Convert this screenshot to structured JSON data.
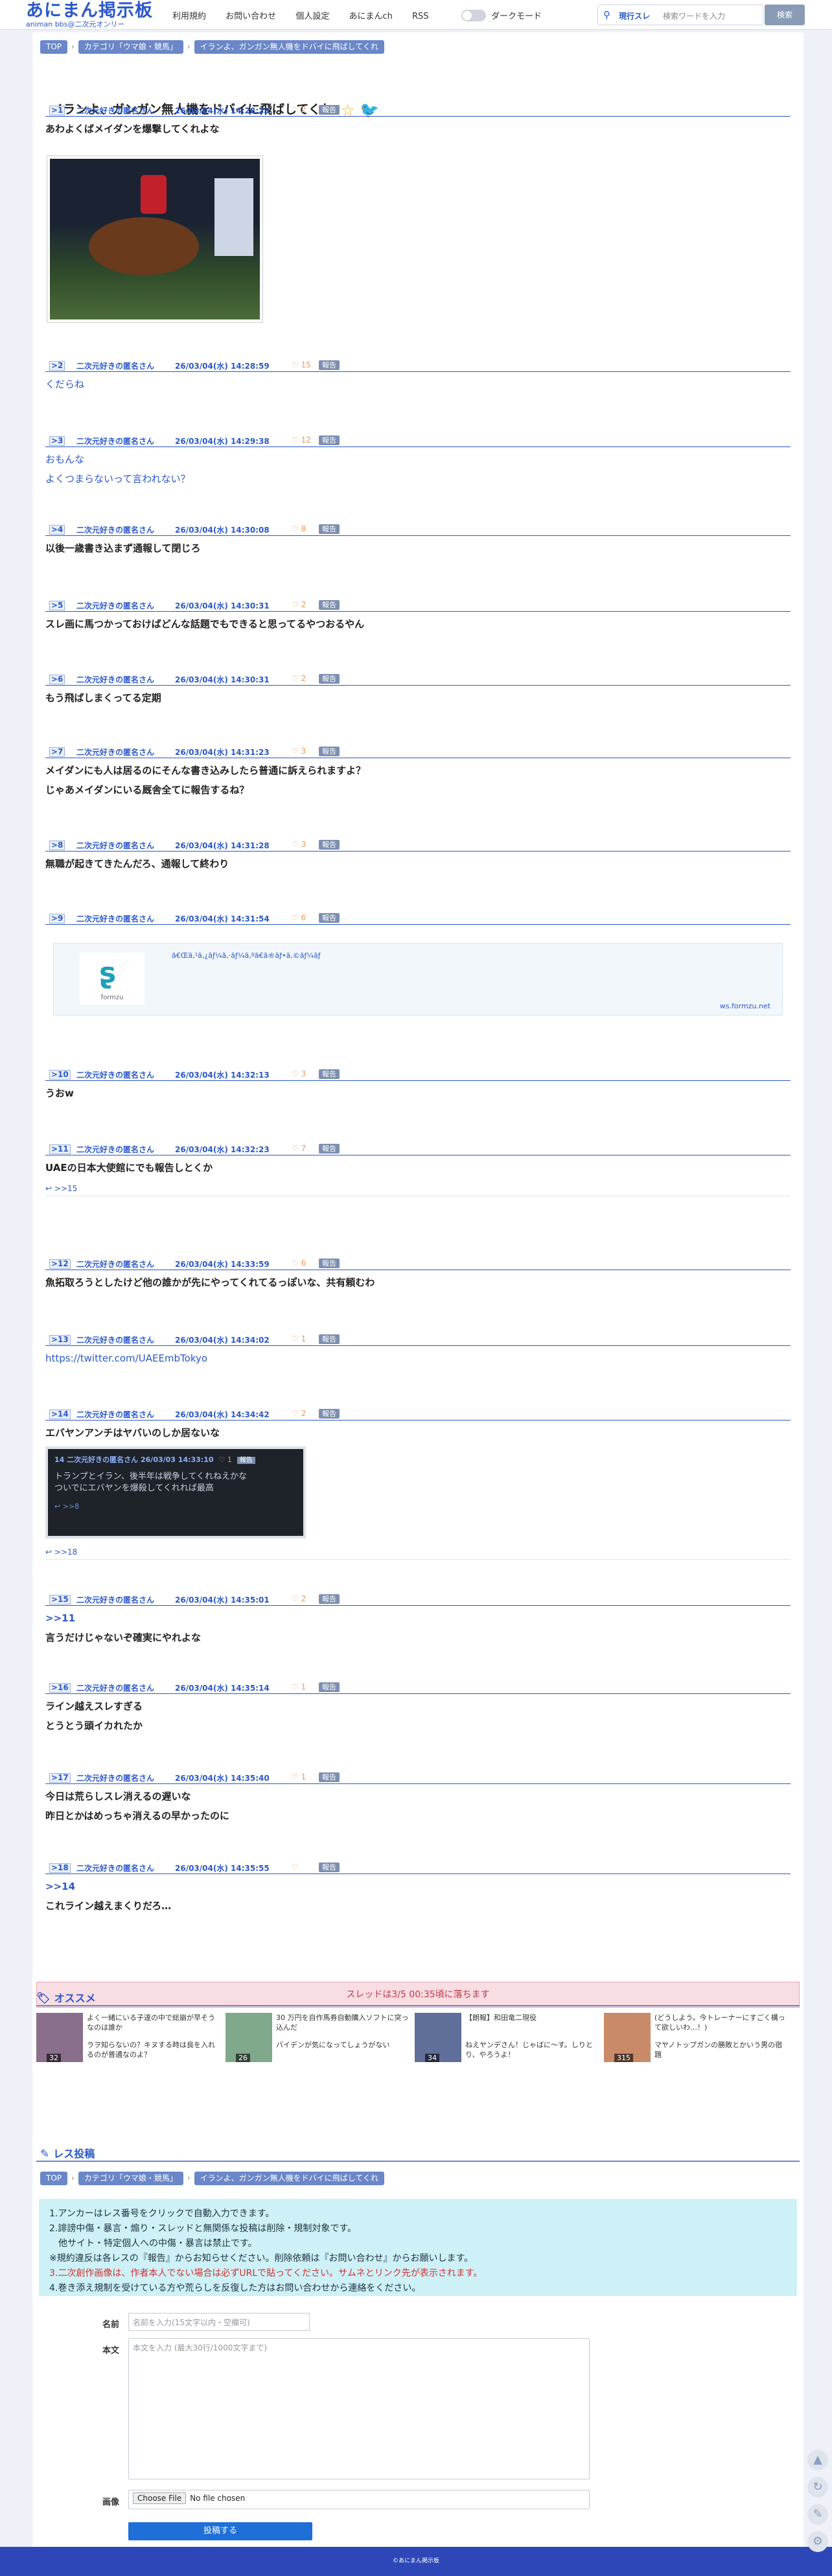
{
  "header": {
    "logo_title": "あにまん掲示板",
    "logo_sub": "animan bbs@二次元オンリー",
    "nav": [
      "利用規約",
      "お問い合わせ",
      "個人設定",
      "あにまんch",
      "RSS"
    ],
    "dark_mode_label": "ダークモード",
    "search_scope": "現行スレ",
    "search_placeholder": "検索ワードを入力",
    "search_button": "検索"
  },
  "breadcrumb": [
    "TOP",
    "カテゴリ「ウマ娘・競馬」",
    "イランよ、ガンガン無人機をドバイに飛ばしてくれ"
  ],
  "thread_title": "イランよ、ガンガン無人機をドバイに飛ばしてくれ",
  "report_label": "報告",
  "posts": [
    {
      "no": "1",
      "name": "二次元好きの匿名さん",
      "date": "26/03/04(水) 14:28:23",
      "likes": "2",
      "lines": [
        "あわよくばメイダンを爆撃してくれよな"
      ]
    },
    {
      "no": "2",
      "name": "二次元好きの匿名さん",
      "date": "26/03/04(水) 14:28:59",
      "likes": "15",
      "lines": [
        "くだらね"
      ]
    },
    {
      "no": "3",
      "name": "二次元好きの匿名さん",
      "date": "26/03/04(水) 14:29:38",
      "likes": "12",
      "lines": [
        "おもんな",
        "よくつまらないって言われない？"
      ]
    },
    {
      "no": "4",
      "name": "二次元好きの匿名さん",
      "date": "26/03/04(水) 14:30:08",
      "likes": "8",
      "lines": [
        "以後一歳書き込まず通報して閉じろ"
      ]
    },
    {
      "no": "5",
      "name": "二次元好きの匿名さん",
      "date": "26/03/04(水) 14:30:31",
      "likes": "2",
      "lines": [
        "スレ画に馬つかっておけばどんな話題でもできると思ってるやつおるやん"
      ]
    },
    {
      "no": "6",
      "name": "二次元好きの匿名さん",
      "date": "26/03/04(水) 14:30:31",
      "likes": "2",
      "lines": [
        "もう飛ばしまくってる定期"
      ]
    },
    {
      "no": "7",
      "name": "二次元好きの匿名さん",
      "date": "26/03/04(水) 14:31:23",
      "likes": "3",
      "lines": [
        "メイダンにも人は居るのにそんな書き込みしたら普通に訴えられますよ？",
        "じゃあメイダンにいる厩舎全てに報告するね？"
      ]
    },
    {
      "no": "8",
      "name": "二次元好きの匿名さん",
      "date": "26/03/04(水) 14:31:28",
      "likes": "3",
      "lines": [
        "無職が起きてきたんだろ、通報して終わり"
      ]
    },
    {
      "no": "9",
      "name": "二次元好きの匿名さん",
      "date": "26/03/04(水) 14:31:54",
      "likes": "6",
      "lines": []
    },
    {
      "no": "10",
      "name": "二次元好きの匿名さん",
      "date": "26/03/04(水) 14:32:13",
      "likes": "3",
      "lines": [
        "うおw"
      ]
    },
    {
      "no": "11",
      "name": "二次元好きの匿名さん",
      "date": "26/03/04(水) 14:32:23",
      "likes": "7",
      "lines": [
        "UAEの日本大使館にでも報告しとくか"
      ]
    },
    {
      "no": "12",
      "name": "二次元好きの匿名さん",
      "date": "26/03/04(水) 14:33:59",
      "likes": "6",
      "lines": [
        "魚拓取ろうとしたけど他の誰かが先にやってくれてるっぽいな、共有頼むわ"
      ]
    },
    {
      "no": "13",
      "name": "二次元好きの匿名さん",
      "date": "26/03/04(水) 14:34:02",
      "likes": "1",
      "lines": [
        "https://twitter.com/UAEEmbTokyo"
      ]
    },
    {
      "no": "14",
      "name": "二次元好きの匿名さん",
      "date": "26/03/04(水) 14:34:42",
      "likes": "2",
      "lines": [
        "エバヤンアンチはヤバいのしか居ないな"
      ]
    },
    {
      "no": "15",
      "name": "二次元好きの匿名さん",
      "date": "26/03/04(水) 14:35:01",
      "likes": "2",
      "lines": [
        ">>11",
        "言うだけじゃないぞ確実にやれよな"
      ]
    },
    {
      "no": "16",
      "name": "二次元好きの匿名さん",
      "date": "26/03/04(水) 14:35:14",
      "likes": "1",
      "lines": [
        "ライン越えスレすぎる",
        "とうとう頭イカれたか"
      ]
    },
    {
      "no": "17",
      "name": "二次元好きの匿名さん",
      "date": "26/03/04(水) 14:35:40",
      "likes": "1",
      "lines": [
        "今日は荒らしスレ消えるの遅いな",
        "昨日とかはめっちゃ消えるの早かったのに"
      ]
    },
    {
      "no": "18",
      "name": "二次元好きの匿名さん",
      "date": "26/03/04(水) 14:35:55",
      "likes": "",
      "lines": [
        ">>14",
        "これライン越えまくりだろ…"
      ]
    }
  ],
  "replies": {
    "p11": ">>15",
    "p14": ">>18",
    "emb": ">>8"
  },
  "ogp": {
    "logo_name": "formzu",
    "title": "ã€Œã‚¹ã‚¿ãƒ¼ã‚·ãƒ¼ã‚ºã€ã®ãƒ•ã‚©ãƒ¼ãƒ ",
    "domain": "ws.formzu.net"
  },
  "embed": {
    "no": "14",
    "name": "二次元好きの匿名さん",
    "date": "26/03/03 14:33:10",
    "likes": "1",
    "text1": "トランプとイラン、後半年は戦争してくれねえかな",
    "text2": "ついでにエバヤンを爆殺してくれれば最高"
  },
  "fall_notice": "スレッドは3/5 00:35頃に落ちます",
  "recommend": {
    "title": "オススメ",
    "items": [
      {
        "t1": "よく一緒にいる子達の中で総崩が早そうなのは誰か",
        "t2": "ラヲ知らないの？キヌする時は良を入れるのが普通なのよ？",
        "cnt": "32"
      },
      {
        "t1": "30 万円を自作馬券自動購入ソフトに突っ込んだ",
        "t2": "バイデンが気になってしょうがない",
        "cnt": "26"
      },
      {
        "t1": "【朗報】和田竜二現役",
        "t2": "ねえヤンデさん！じゃばに〜す。しりとり、やろうよ！",
        "cnt": "34"
      },
      {
        "t1": "(どうしよう。今トレーナーにすごく構って欲しいわ…！)",
        "t2": "マヤノトップガンの勝敗とかいう男の宿題",
        "cnt": "315"
      }
    ]
  },
  "form": {
    "title": "レス投稿",
    "rules": [
      "1.アンカーはレス番号をクリックで自動入力できます。",
      "2.誹謗中傷・暴言・煽り・スレッドと無関係な投稿は削除・規制対象です。",
      "　他サイト・特定個人への中傷・暴言は禁止です。",
      "※規約違反は各レスの『報告』からお知らせください。削除依頼は『お問い合わせ』からお願いします。",
      "3.二次創作画像は、作者本人でない場合は必ずURLで貼ってください。サムネとリンク先が表示されます。",
      "4.巻き添え規制を受けている方や荒らしを反復した方はお問い合わせから連絡をください。"
    ],
    "name_label": "名前",
    "name_placeholder": "名前を入力(15文字以内・空欄可)",
    "body_label": "本文",
    "body_placeholder": "本文を入力 (最大30行/1000文字まで)",
    "image_label": "画像",
    "file_button": "Choose File",
    "file_status": "No file chosen",
    "submit": "投稿する"
  },
  "footer": "©あにまん掲示板",
  "colors": {
    "accent": "#2b58c9",
    "footer": "#2e47b8",
    "notice_bg": "#f8dde2",
    "rules_bg": "#cdf1f7"
  }
}
